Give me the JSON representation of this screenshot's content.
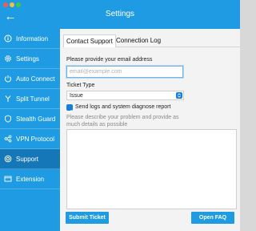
{
  "window": {
    "title": "Settings"
  },
  "sidebar": {
    "items": [
      {
        "label": "Information",
        "icon": "info-icon"
      },
      {
        "label": "Settings",
        "icon": "gear-icon"
      },
      {
        "label": "Auto Connect",
        "icon": "power-icon"
      },
      {
        "label": "Split Tunnel",
        "icon": "split-tunnel-icon"
      },
      {
        "label": "Stealth Guard",
        "icon": "stealth-guard-icon"
      },
      {
        "label": "VPN Protocol",
        "icon": "vpn-protocol-icon"
      },
      {
        "label": "Support",
        "icon": "support-icon",
        "active": true
      },
      {
        "label": "Extension",
        "icon": "extension-icon"
      }
    ]
  },
  "tabs": [
    {
      "label": "Contact Support",
      "active": true
    },
    {
      "label": "Connection Log",
      "active": false
    }
  ],
  "form": {
    "email_label": "Please provide your email address",
    "email_placeholder": "email@example.com",
    "email_value": "",
    "ticket_type_label": "Ticket Type",
    "ticket_type_value": "Issue",
    "send_logs_label": "Send logs and system diagnose report",
    "send_logs_checked": true,
    "description_placeholder": "Please describe your problem and provide as much details as possible"
  },
  "buttons": {
    "submit": "Submit Ticket",
    "faq": "Open FAQ"
  },
  "colors": {
    "accent": "#1e9be2",
    "sidebar_active": "#1577b7",
    "checkbox": "#1a7fd8"
  }
}
